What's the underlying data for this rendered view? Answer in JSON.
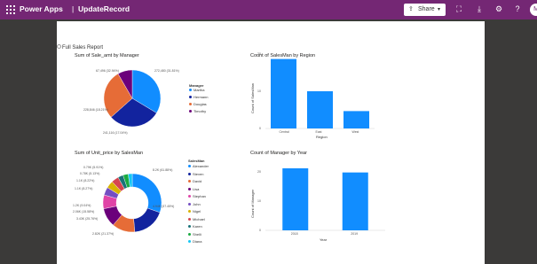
{
  "topbar": {
    "app_name": "Power Apps",
    "separator": "|",
    "app_title": "UpdateRecord",
    "share_label": "Share",
    "avatar_initial": "M",
    "icons": [
      "waffle-icon",
      "share-icon",
      "chevron-down-icon",
      "fit-screen-icon",
      "download-icon",
      "settings-icon",
      "help-icon"
    ]
  },
  "report": {
    "title": "Full Sales Report"
  },
  "charts": {
    "pie_title": "Sum of Sale_amt by Manager",
    "pie_legend_title": "Manager",
    "pie_legend": [
      "Martha",
      "Hermann",
      "Douglas",
      "Timothy"
    ],
    "pie_labels": [
      "67,496 (32.94%)",
      "228,846 (18.21%)",
      "241,116 (17.04%)",
      "272,480 (31.81%)"
    ],
    "region_title": "Count of SalesMan by Region",
    "region_ylabel": "Count of SalesMan",
    "region_xlabel": "Region",
    "region_ticks": [
      "20",
      "10",
      "0"
    ],
    "donut_title": "Sum of Unit_price by SalesMan",
    "donut_legend_title": "SalesMan",
    "donut_legend": [
      "Alexander",
      "Steven",
      "David",
      "Lisa",
      "Stephan",
      "John",
      "Nigel",
      "Michael",
      "Karen",
      "Shelli",
      "Diana"
    ],
    "donut_labels": [
      "0.79K (5.91%)",
      "0.78K (5.13%)",
      "1.1K (8.22%)",
      "1.1K (8.27%)",
      "1.2K (9.04%)",
      "2.06K (15.58%)",
      "3.43K (25.76%)",
      "2.82K (21.37%)",
      "4.94K (37.45%)",
      "8.2K (61.88%)"
    ],
    "year_title": "Count of Manager by Year",
    "year_ylabel": "Count of Manager",
    "year_xlabel": "Year",
    "year_ticks": [
      "20",
      "10",
      "0"
    ]
  },
  "chart_data": [
    {
      "type": "pie",
      "title": "Sum of Sale_amt by Manager",
      "categories": [
        "Martha",
        "Hermann",
        "Douglas",
        "Timothy"
      ],
      "values": [
        272480,
        241116,
        228846,
        67496
      ],
      "colors": [
        "#118DFF",
        "#12239E",
        "#E66C37",
        "#6B007B"
      ]
    },
    {
      "type": "bar",
      "title": "Count of SalesMan by Region",
      "categories": [
        "Central",
        "East",
        "West"
      ],
      "values": [
        28,
        15,
        7
      ],
      "ylim": [
        0,
        30
      ],
      "xlabel": "Region",
      "ylabel": "Count of SalesMan",
      "color": "#118DFF"
    },
    {
      "type": "pie",
      "title": "Sum of Unit_price by SalesMan",
      "categories": [
        "Alexander",
        "Steven",
        "David",
        "Lisa",
        "Stephan",
        "John",
        "Nigel",
        "Michael",
        "Karen",
        "Shelli",
        "Diana"
      ],
      "values": [
        8.2,
        4.94,
        3.43,
        2.82,
        2.06,
        1.2,
        1.1,
        1.1,
        0.79,
        0.78,
        0.6
      ],
      "colors": [
        "#118DFF",
        "#12239E",
        "#E66C37",
        "#6B007B",
        "#E044A7",
        "#744EC2",
        "#D9B300",
        "#D64550",
        "#197278",
        "#1AAB40",
        "#15C6F4"
      ]
    },
    {
      "type": "bar",
      "title": "Count of Manager by Year",
      "categories": [
        "2018",
        "2019"
      ],
      "values": [
        30,
        28
      ],
      "ylim": [
        0,
        30
      ],
      "xlabel": "Year",
      "ylabel": "Count of Manager",
      "color": "#118DFF"
    }
  ]
}
